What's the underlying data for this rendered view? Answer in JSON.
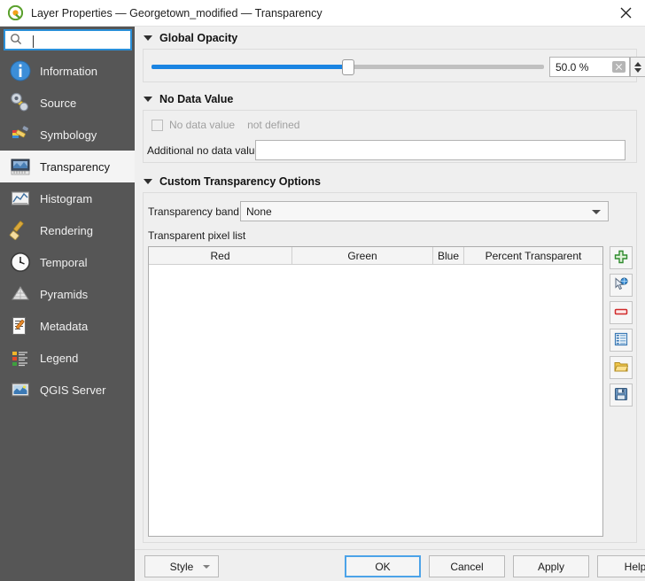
{
  "window": {
    "title": "Layer Properties — Georgetown_modified — Transparency",
    "app_icon": "qgis-logo-icon",
    "close_icon": "close-icon"
  },
  "sidebar": {
    "search": {
      "value": "",
      "placeholder": "",
      "icon": "search-icon"
    },
    "items": [
      {
        "label": "Information",
        "icon": "information-icon",
        "selected": false
      },
      {
        "label": "Source",
        "icon": "source-icon",
        "selected": false
      },
      {
        "label": "Symbology",
        "icon": "symbology-icon",
        "selected": false
      },
      {
        "label": "Transparency",
        "icon": "transparency-icon",
        "selected": true
      },
      {
        "label": "Histogram",
        "icon": "histogram-icon",
        "selected": false
      },
      {
        "label": "Rendering",
        "icon": "rendering-icon",
        "selected": false
      },
      {
        "label": "Temporal",
        "icon": "temporal-icon",
        "selected": false
      },
      {
        "label": "Pyramids",
        "icon": "pyramids-icon",
        "selected": false
      },
      {
        "label": "Metadata",
        "icon": "metadata-icon",
        "selected": false
      },
      {
        "label": "Legend",
        "icon": "legend-icon",
        "selected": false
      },
      {
        "label": "QGIS Server",
        "icon": "qgis-server-icon",
        "selected": false
      }
    ]
  },
  "global_opacity": {
    "section_title": "Global Opacity",
    "slider_percent": 50,
    "spin_value": "50.0 %",
    "clear_icon": "clear-icon",
    "stepper_icon": "spinner-arrows-icon"
  },
  "no_data_value": {
    "section_title": "No Data Value",
    "checkbox_label": "No data value",
    "checkbox_checked": false,
    "status_text": "not defined",
    "additional_label": "Additional no data value",
    "additional_value": "",
    "additional_placeholder": ""
  },
  "custom_transparency": {
    "section_title": "Custom Transparency Options",
    "band_label": "Transparency band",
    "band_value": "None",
    "pixel_list_label": "Transparent pixel list",
    "columns": [
      "Red",
      "Green",
      "Blue",
      "Percent Transparent"
    ],
    "rows": [],
    "tools": [
      {
        "name": "add-values-manually-button",
        "icon": "green-plus-icon"
      },
      {
        "name": "add-values-from-display-button",
        "icon": "cursor-pick-icon"
      },
      {
        "name": "remove-selected-row-button",
        "icon": "red-minus-icon"
      },
      {
        "name": "default-values-button",
        "icon": "blue-table-icon"
      },
      {
        "name": "import-from-file-button",
        "icon": "folder-open-icon"
      },
      {
        "name": "export-to-file-button",
        "icon": "floppy-save-icon"
      }
    ]
  },
  "footer": {
    "style_label": "Style",
    "ok_label": "OK",
    "cancel_label": "Cancel",
    "apply_label": "Apply",
    "help_label": "Help"
  },
  "colors": {
    "accent_blue": "#1a84e2",
    "sidebar_bg": "#565656",
    "panel_bg": "#efefef",
    "focus_border": "#2a8fd8"
  }
}
